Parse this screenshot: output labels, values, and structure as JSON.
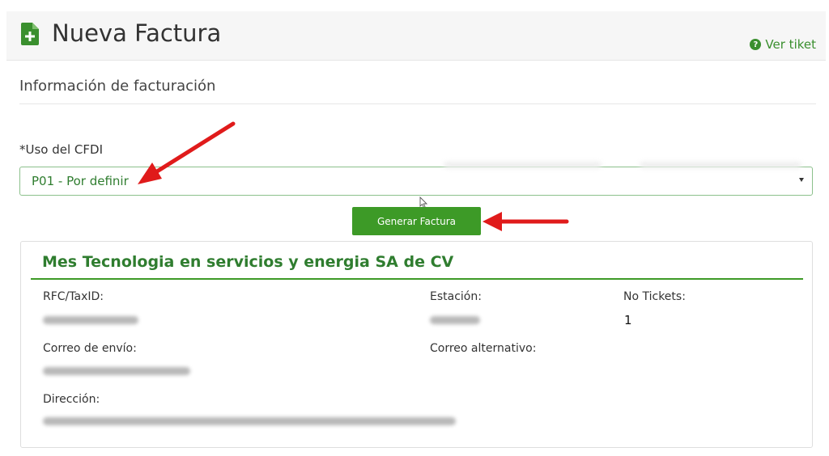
{
  "header": {
    "title": "Nueva Factura",
    "help_link": "Ver tiket",
    "help_icon_glyph": "?",
    "icon": "file-plus-icon"
  },
  "section": {
    "title": "Información de facturación"
  },
  "form": {
    "cfdi_label": "*Uso del CFDI",
    "cfdi_value": "P01 - Por definir",
    "submit_label": "Generar Factura"
  },
  "company": {
    "name": "Mes Tecnologia en servicios y energia SA de CV",
    "rfc_label": "RFC/TaxID:",
    "estacion_label": "Estación:",
    "tickets_label": "No Tickets:",
    "tickets_value": "1",
    "correo_label": "Correo de envío:",
    "correo_alt_label": "Correo alternativo:",
    "direccion_label": "Dirección:"
  },
  "colors": {
    "brand_green": "#3d9a27",
    "text_green": "#2f7d2f",
    "annotation_arrow": "#e01b1b"
  }
}
